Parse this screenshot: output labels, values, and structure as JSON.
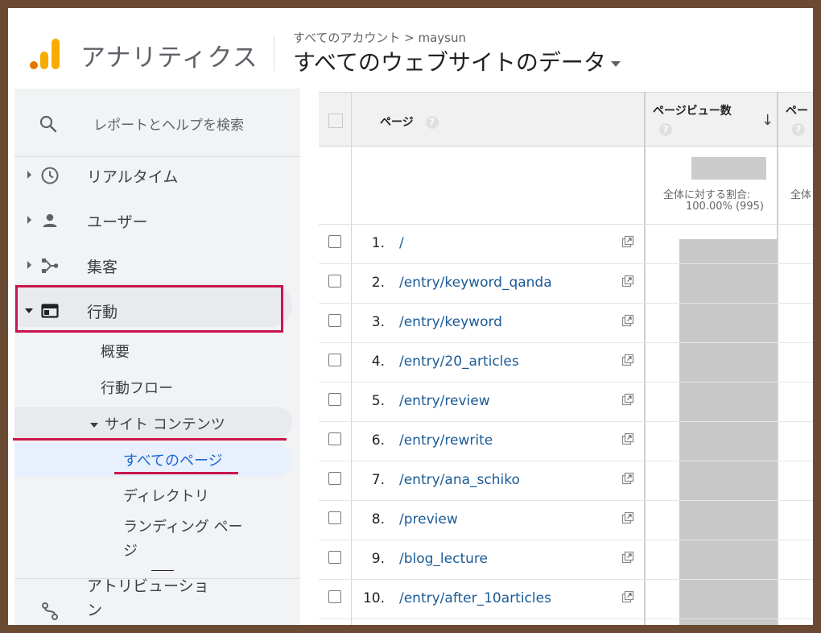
{
  "header": {
    "app_title": "アナリティクス",
    "breadcrumb": "すべてのアカウント > maysun",
    "view_title": "すべてのウェブサイトのデータ"
  },
  "colors": {
    "highlight_red": "#c9154c",
    "link_blue": "#1a5a96",
    "logo_orange": "#f9ab00",
    "logo_dark_orange": "#e37400"
  },
  "sidebar": {
    "search_label": "レポートとヘルプを検索",
    "items": [
      {
        "label": "リアルタイム",
        "icon": "clock-icon"
      },
      {
        "label": "ユーザー",
        "icon": "person-icon"
      },
      {
        "label": "集客",
        "icon": "acquisition-icon"
      },
      {
        "label": "行動",
        "icon": "behavior-icon"
      }
    ],
    "behavior_sub": {
      "overview": "概要",
      "flow": "行動フロー",
      "site_content": "サイト コンテンツ",
      "all_pages": "すべてのページ",
      "directory": "ディレクトリ",
      "landing_line1": "ランディング ペー",
      "landing_line2": "ジ"
    },
    "attribution_line1": "アトリビューショ",
    "attribution_line2": "ン"
  },
  "table": {
    "col_page": "ページ",
    "col_pageviews": "ページビュー数",
    "col3": "ペー",
    "help": "?",
    "sort_arrow": "↓",
    "summary_line1": "全体に対する割合:",
    "summary_line2": "100.00% (995)",
    "summary_col3": "全体",
    "rows": [
      {
        "num": "1.",
        "page": "/"
      },
      {
        "num": "2.",
        "page": "/entry/keyword_qanda"
      },
      {
        "num": "3.",
        "page": "/entry/keyword"
      },
      {
        "num": "4.",
        "page": "/entry/20_articles"
      },
      {
        "num": "5.",
        "page": "/entry/review"
      },
      {
        "num": "6.",
        "page": "/entry/rewrite"
      },
      {
        "num": "7.",
        "page": "/entry/ana_schiko"
      },
      {
        "num": "8.",
        "page": "/preview"
      },
      {
        "num": "9.",
        "page": "/blog_lecture"
      },
      {
        "num": "10.",
        "page": "/entry/after_10articles"
      }
    ]
  }
}
